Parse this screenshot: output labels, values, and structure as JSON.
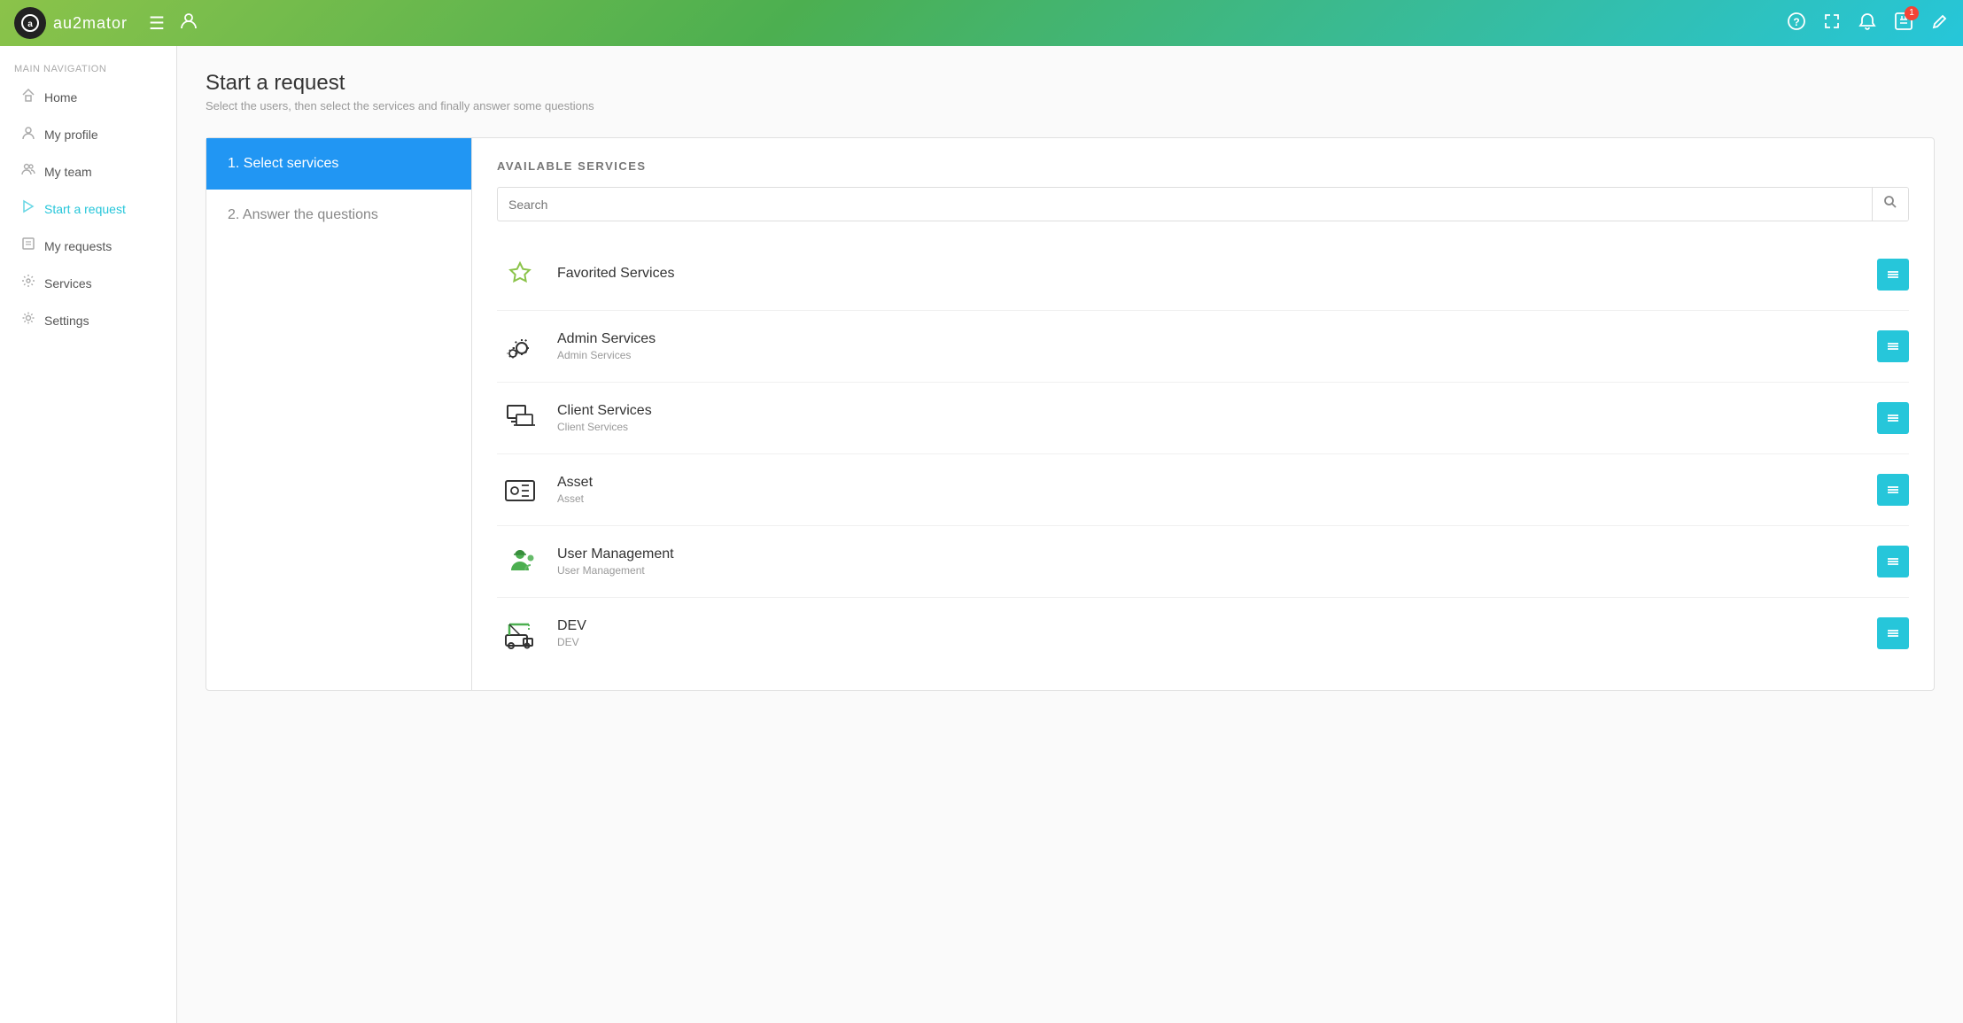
{
  "header": {
    "logo_text": "au2mator",
    "logo_initials": "a",
    "menu_icon": "☰",
    "user_icon": "👤",
    "icons": {
      "help": "?",
      "expand": "⤢",
      "bell": "🔔",
      "cart": "🛒",
      "cart_badge": "1",
      "edit": "✏️"
    }
  },
  "sidebar": {
    "section_label": "Main Navigation",
    "items": [
      {
        "id": "home",
        "label": "Home",
        "icon": "⌂"
      },
      {
        "id": "my-profile",
        "label": "My profile",
        "icon": "👤"
      },
      {
        "id": "my-team",
        "label": "My team",
        "icon": "👥"
      },
      {
        "id": "start-a-request",
        "label": "Start a request",
        "icon": "▷"
      },
      {
        "id": "my-requests",
        "label": "My requests",
        "icon": "📋"
      },
      {
        "id": "services",
        "label": "Services",
        "icon": "⚙"
      },
      {
        "id": "settings",
        "label": "Settings",
        "icon": "🔧"
      }
    ]
  },
  "page": {
    "title": "Start a request",
    "subtitle": "Select the users, then select the services and finally answer some questions"
  },
  "steps": [
    {
      "number": "1.",
      "label": "Select services",
      "active": true
    },
    {
      "number": "2.",
      "label": "Answer the questions",
      "active": false
    }
  ],
  "services_panel": {
    "header": "AVAILABLE SERVICES",
    "search_placeholder": "Search",
    "services": [
      {
        "id": "favorited",
        "name": "Favorited Services",
        "desc": "",
        "icon_type": "star"
      },
      {
        "id": "admin",
        "name": "Admin Services",
        "desc": "Admin Services",
        "icon_type": "gear"
      },
      {
        "id": "client",
        "name": "Client Services",
        "desc": "Client Services",
        "icon_type": "monitor"
      },
      {
        "id": "asset",
        "name": "Asset",
        "desc": "Asset",
        "icon_type": "asset"
      },
      {
        "id": "user-management",
        "name": "User Management",
        "desc": "User Management",
        "icon_type": "user"
      },
      {
        "id": "dev",
        "name": "DEV",
        "desc": "DEV",
        "icon_type": "dev"
      }
    ],
    "btn_icon": "≡"
  }
}
